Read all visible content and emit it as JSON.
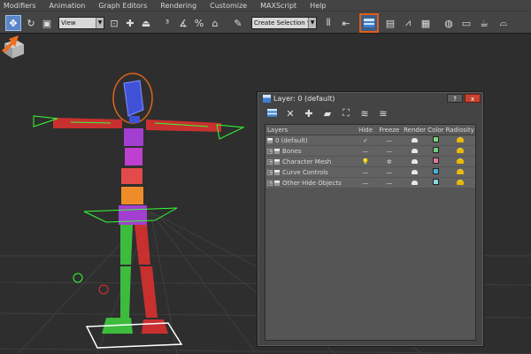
{
  "menu": [
    "Modifiers",
    "Animation",
    "Graph Editors",
    "Rendering",
    "Customize",
    "MAXScript",
    "Help"
  ],
  "toolbar": {
    "view_combo": "View",
    "selection_set_combo": "Create Selection Se",
    "highlighted_tool": "layer-explorer-icon"
  },
  "dialog": {
    "title": "Layer: 0 (default)",
    "help_button": "?",
    "close_button": "x",
    "toolbar_icons": [
      "layer-icon",
      "delete-icon",
      "add-icon",
      "add-selection-icon",
      "select-objects-icon",
      "highlight-layer-icon",
      "current-layer-icon"
    ],
    "columns": [
      "Layers",
      "Hide",
      "Freeze",
      "Render",
      "Color",
      "Radiosity"
    ],
    "rows": [
      {
        "name": "0 (default)",
        "current": "✓",
        "hide": "—",
        "freeze": "—",
        "color": "#7fd17f"
      },
      {
        "name": "Bones",
        "hide": "—",
        "freeze": "—",
        "color": "#73c97c"
      },
      {
        "name": "Character Mesh",
        "hide": "💡",
        "freeze": "✲",
        "color": "#e47a9c"
      },
      {
        "name": "Curve Controls",
        "hide": "—",
        "freeze": "—",
        "color": "#46b3d8"
      },
      {
        "name": "Other Hide Objects",
        "hide": "—",
        "freeze": "—",
        "color": "#8dd6df"
      }
    ]
  },
  "colors": {
    "highlight_border": "#e25d14",
    "arrow": "#f26d1d",
    "selected_tool": "#5a86c8"
  }
}
